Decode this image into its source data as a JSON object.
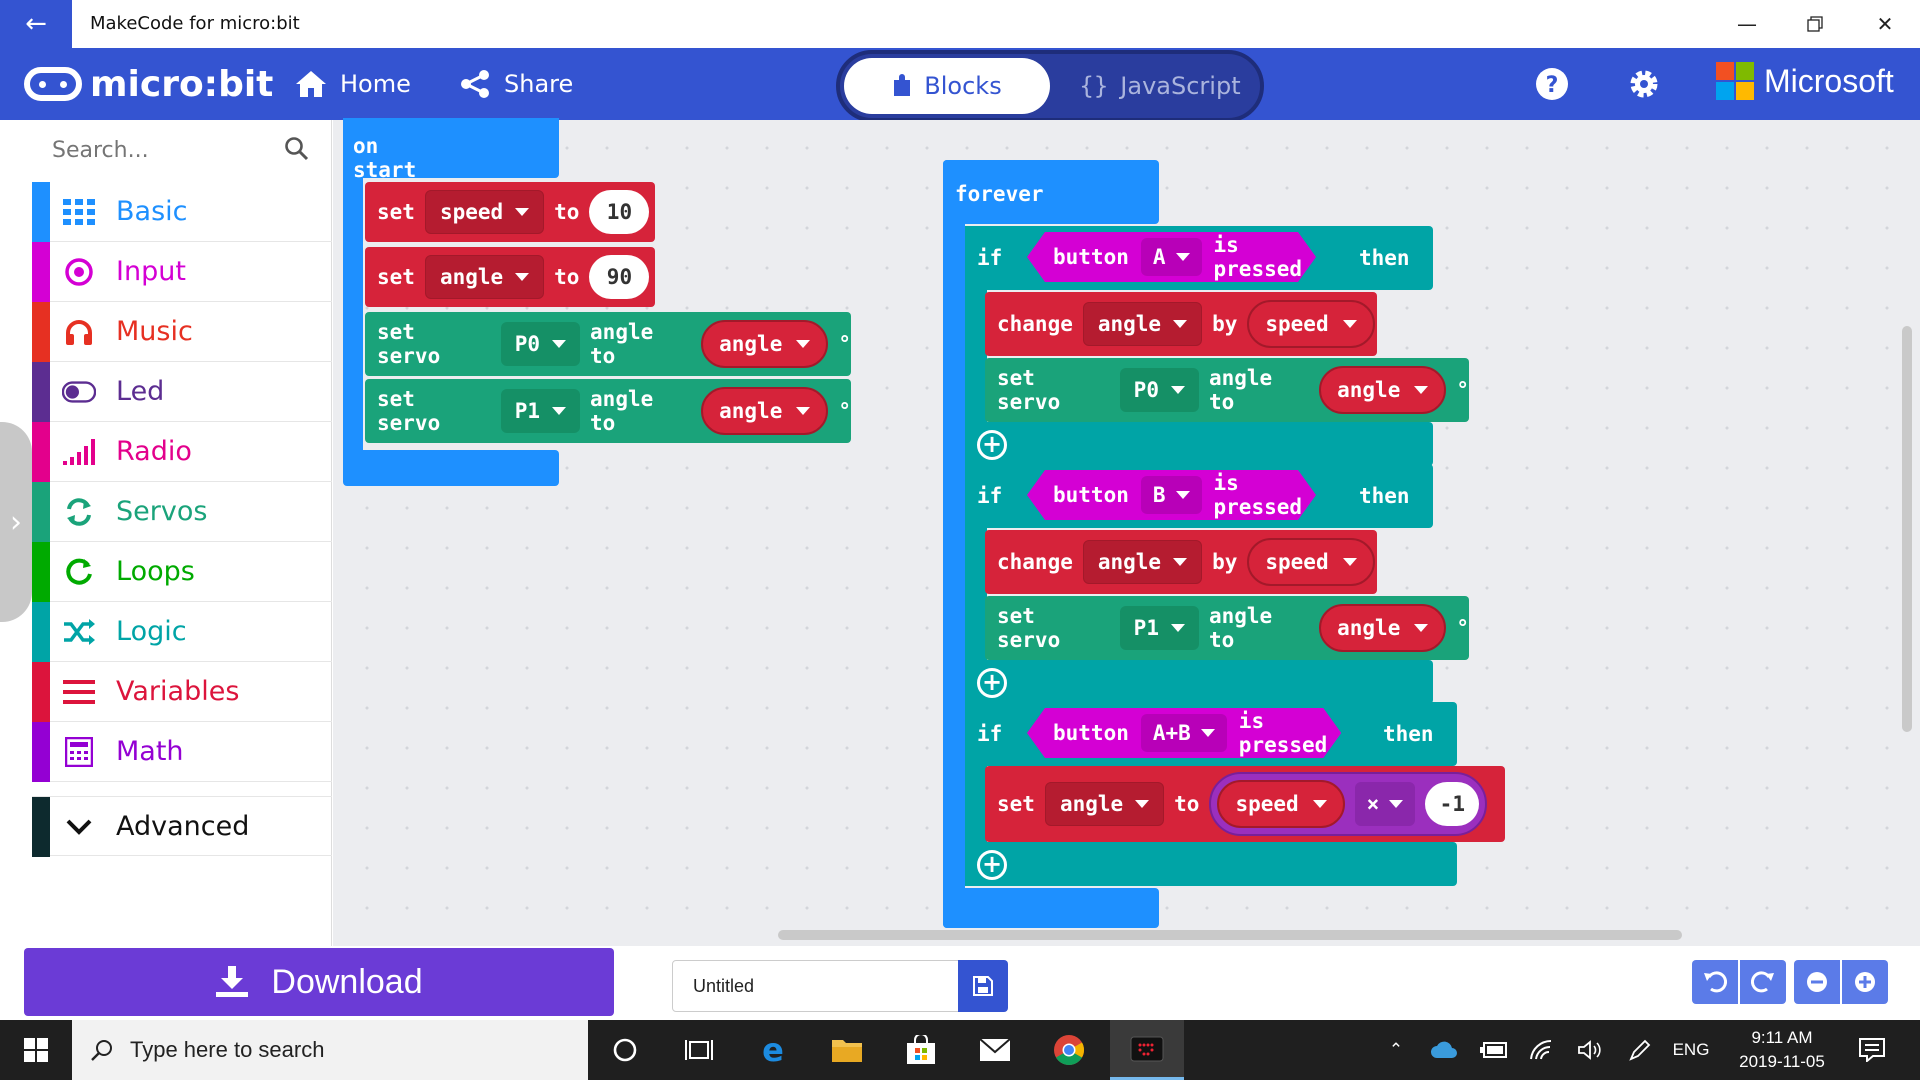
{
  "window": {
    "title": "MakeCode for micro:bit"
  },
  "header": {
    "logo_text": "micro:bit",
    "home_label": "Home",
    "share_label": "Share",
    "mode_blocks": "Blocks",
    "mode_js": "JavaScript",
    "brand": "Microsoft"
  },
  "toolbox": {
    "search_placeholder": "Search...",
    "categories": [
      {
        "label": "Basic",
        "color": "#1e90ff",
        "icon": "grid-icon"
      },
      {
        "label": "Input",
        "color": "#d400d4",
        "icon": "target-icon"
      },
      {
        "label": "Music",
        "color": "#e63022",
        "icon": "headphones-icon"
      },
      {
        "label": "Led",
        "color": "#5c2d91",
        "icon": "toggle-icon"
      },
      {
        "label": "Radio",
        "color": "#e3008c",
        "icon": "signal-bars-icon"
      },
      {
        "label": "Servos",
        "color": "#1aa37a",
        "icon": "refresh-icon"
      },
      {
        "label": "Loops",
        "color": "#00aa00",
        "icon": "loop-icon"
      },
      {
        "label": "Logic",
        "color": "#00a4a6",
        "icon": "shuffle-icon"
      },
      {
        "label": "Variables",
        "color": "#dc143c",
        "icon": "lines-icon"
      },
      {
        "label": "Math",
        "color": "#9400d3",
        "icon": "calculator-icon"
      }
    ],
    "advanced_label": "Advanced"
  },
  "blocks": {
    "on_start": {
      "label": "on start",
      "set_speed": {
        "kw_set": "set",
        "var": "speed",
        "kw_to": "to",
        "value": "10"
      },
      "set_angle": {
        "kw_set": "set",
        "var": "angle",
        "kw_to": "to",
        "value": "90"
      },
      "servo_p0": {
        "kw": "set servo",
        "pin": "P0",
        "kw2": "angle to",
        "var": "angle",
        "unit": "°"
      },
      "servo_p1": {
        "kw": "set servo",
        "pin": "P1",
        "kw2": "angle to",
        "var": "angle",
        "unit": "°"
      }
    },
    "forever": {
      "label": "forever",
      "if_a": {
        "kw_if": "if",
        "kw_button": "button",
        "button": "A",
        "kw_pressed": "is pressed",
        "kw_then": "then",
        "change": {
          "kw": "change",
          "var": "angle",
          "kw_by": "by",
          "by_var": "speed"
        },
        "servo": {
          "kw": "set servo",
          "pin": "P0",
          "kw2": "angle to",
          "var": "angle",
          "unit": "°"
        }
      },
      "if_b": {
        "kw_if": "if",
        "kw_button": "button",
        "button": "B",
        "kw_pressed": "is pressed",
        "kw_then": "then",
        "change": {
          "kw": "change",
          "var": "angle",
          "kw_by": "by",
          "by_var": "speed"
        },
        "servo": {
          "kw": "set servo",
          "pin": "P1",
          "kw2": "angle to",
          "var": "angle",
          "unit": "°"
        }
      },
      "if_ab": {
        "kw_if": "if",
        "kw_button": "button",
        "button": "A+B",
        "kw_pressed": "is pressed",
        "kw_then": "then",
        "set": {
          "kw_set": "set",
          "var": "angle",
          "kw_to": "to",
          "left": "speed",
          "op": "×",
          "right": "-1"
        }
      }
    }
  },
  "bottom": {
    "download_label": "Download",
    "project_name": "Untitled"
  },
  "taskbar": {
    "search_placeholder": "Type here to search",
    "lang": "ENG",
    "time": "9:11 AM",
    "date": "2019-11-05"
  }
}
